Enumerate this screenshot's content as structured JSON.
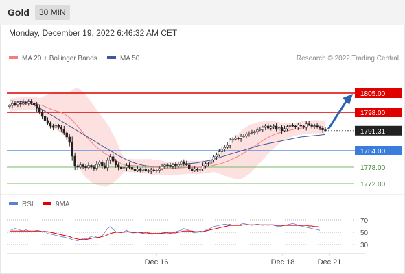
{
  "header": {
    "symbol": "Gold",
    "timeframe": "30 MIN",
    "datetime": "Monday, December 19, 2022 6:46:32 AM CET"
  },
  "legend": {
    "ma20_label": "MA 20 + Bollinger Bands",
    "ma50_label": "MA 50",
    "credit": "Research © 2022 Trading Central",
    "rsi_label": "RSI",
    "rsi_ma_label": "9MA"
  },
  "colors": {
    "ma20": "#f08080",
    "band_fill": "#fde0e0",
    "ma50": "#3d5a98",
    "resistance": "#e00000",
    "pivot": "#3b7ddd",
    "support": "#7ab86a",
    "last_price": "#222222",
    "rsi": "#5b7fd1",
    "rsi_ma": "#e00000",
    "arrow": "#2a64b0"
  },
  "chart_data": [
    {
      "type": "candlestick",
      "x_ticks": [
        "Dec 16",
        "Dec 18",
        "Dec 21"
      ],
      "ylim": [
        1768,
        1808
      ],
      "levels": [
        {
          "value": 1805.0,
          "label": "1805.00",
          "kind": "resistance"
        },
        {
          "value": 1798.0,
          "label": "1798.00",
          "kind": "resistance"
        },
        {
          "value": 1791.31,
          "label": "1791.31",
          "kind": "last"
        },
        {
          "value": 1784.0,
          "label": "1784.00",
          "kind": "pivot"
        },
        {
          "value": 1778.0,
          "label": "1778.00",
          "kind": "support"
        },
        {
          "value": 1772.0,
          "label": "1772.00",
          "kind": "support"
        }
      ],
      "close": [
        1800.5,
        1801.2,
        1800.8,
        1801.5,
        1801.0,
        1801.6,
        1801.4,
        1801.9,
        1801.3,
        1800.8,
        1799.5,
        1798.0,
        1796.5,
        1795.0,
        1794.0,
        1793.0,
        1792.5,
        1793.2,
        1792.5,
        1791.8,
        1790.5,
        1789.0,
        1787.0,
        1782.0,
        1778.5,
        1778.0,
        1778.8,
        1778.2,
        1777.8,
        1778.6,
        1778.0,
        1777.6,
        1779.0,
        1779.8,
        1778.5,
        1777.8,
        1780.5,
        1781.8,
        1780.2,
        1778.8,
        1778.0,
        1777.4,
        1777.8,
        1778.6,
        1777.9,
        1777.2,
        1776.8,
        1777.3,
        1776.9,
        1777.4,
        1776.8,
        1776.5,
        1777.0,
        1776.7,
        1776.9,
        1777.5,
        1778.2,
        1778.8,
        1778.6,
        1778.2,
        1778.9,
        1778.3,
        1779.0,
        1780.0,
        1779.3,
        1778.8,
        1777.5,
        1776.8,
        1777.3,
        1777.0,
        1777.4,
        1778.5,
        1779.3,
        1779.2,
        1780.6,
        1781.8,
        1782.5,
        1783.6,
        1784.6,
        1785.2,
        1786.0,
        1787.8,
        1788.2,
        1788.6,
        1788.4,
        1789.2,
        1789.3,
        1790.1,
        1790.4,
        1790.6,
        1791.0,
        1791.6,
        1791.8,
        1792.5,
        1793.0,
        1792.2,
        1792.8,
        1793.0,
        1791.8,
        1792.4,
        1791.3,
        1792.0,
        1792.8,
        1793.2,
        1793.0,
        1792.6,
        1793.4,
        1793.0,
        1792.6,
        1793.8,
        1793.5,
        1792.9,
        1793.1,
        1792.6,
        1792.2,
        1791.6,
        1791.3
      ],
      "ma50": [
        1802.2,
        1802.2,
        1802.1,
        1802.0,
        1801.9,
        1801.8,
        1801.7,
        1801.4,
        1801.0,
        1800.6,
        1800.2,
        1799.6,
        1799.0,
        1798.4,
        1797.8,
        1797.2,
        1796.6,
        1796.0,
        1795.4,
        1794.8,
        1794.2,
        1793.6,
        1793.0,
        1792.4,
        1791.8,
        1791.2,
        1790.6,
        1790.0,
        1789.4,
        1788.8,
        1788.2,
        1787.6,
        1787.0,
        1786.4,
        1785.8,
        1785.2,
        1784.6,
        1784.0,
        1783.4,
        1782.8,
        1782.2,
        1781.7,
        1781.2,
        1780.7,
        1780.3,
        1779.9,
        1779.5,
        1779.2,
        1778.9,
        1778.7,
        1778.5,
        1778.4,
        1778.3,
        1778.3,
        1778.3,
        1778.3,
        1778.3,
        1778.4,
        1778.5,
        1778.6,
        1778.7,
        1778.8,
        1778.9,
        1779.0,
        1779.1,
        1779.2,
        1779.3,
        1779.4,
        1779.5,
        1779.6,
        1779.8,
        1780.0,
        1780.2,
        1780.4,
        1780.6,
        1780.9,
        1781.2,
        1781.5,
        1781.8,
        1782.1,
        1782.4,
        1782.7,
        1783.0,
        1783.3,
        1783.6,
        1783.9,
        1784.2,
        1784.5,
        1784.8,
        1785.1,
        1785.4,
        1785.7,
        1786.0,
        1786.2,
        1786.4,
        1786.6,
        1786.8,
        1787.0,
        1787.2,
        1787.4,
        1787.6,
        1787.8,
        1788.0,
        1788.2,
        1788.4,
        1788.6,
        1788.8,
        1789.0,
        1789.1,
        1789.2,
        1789.3,
        1789.4,
        1789.5,
        1789.6,
        1789.7,
        1789.8,
        1789.9
      ]
    },
    {
      "type": "line",
      "title": "RSI",
      "ylim": [
        20,
        80
      ],
      "y_ticks": [
        70,
        50,
        30
      ],
      "series": [
        {
          "name": "RSI",
          "values": [
            55,
            54,
            56,
            55,
            53,
            52,
            54,
            52,
            50,
            51,
            53,
            52,
            51,
            52,
            48,
            47,
            46,
            45,
            44,
            43,
            42,
            41,
            40,
            38,
            37,
            36,
            38,
            40,
            39,
            41,
            43,
            44,
            42,
            41,
            44,
            50,
            56,
            59,
            55,
            51,
            50,
            49,
            51,
            53,
            50,
            49,
            49,
            50,
            49,
            48,
            47,
            48,
            47,
            47,
            48,
            48,
            49,
            50,
            49,
            48,
            49,
            51,
            52,
            53,
            56,
            54,
            53,
            50,
            49,
            50,
            52,
            51,
            53,
            55,
            57,
            59,
            60,
            61,
            62,
            63,
            62,
            63,
            61,
            62,
            61,
            63,
            64,
            63,
            62,
            61,
            62,
            63,
            62,
            61,
            62,
            61,
            62,
            61,
            60,
            59,
            60,
            61,
            62,
            63,
            64,
            63,
            61,
            60,
            59,
            58,
            57,
            56,
            55,
            54,
            53
          ]
        },
        {
          "name": "9MA",
          "values": [
            52,
            52,
            52,
            52,
            52,
            52,
            52,
            52,
            52,
            52,
            52,
            52,
            51,
            51,
            51,
            50,
            49,
            48,
            47,
            46,
            45,
            44,
            43,
            41,
            40,
            39,
            38,
            38,
            38,
            39,
            40,
            41,
            41,
            42,
            43,
            44,
            46,
            48,
            49,
            50,
            50,
            50,
            50,
            51,
            51,
            50,
            50,
            50,
            50,
            49,
            49,
            49,
            48,
            48,
            48,
            48,
            48,
            49,
            49,
            49,
            49,
            49,
            50,
            51,
            52,
            52,
            52,
            52,
            51,
            51,
            51,
            51,
            52,
            53,
            54,
            55,
            56,
            57,
            58,
            59,
            60,
            61,
            61,
            61,
            61,
            61,
            62,
            62,
            62,
            62,
            62,
            62,
            62,
            62,
            62,
            62,
            62,
            62,
            61,
            61,
            61,
            61,
            61,
            61,
            61,
            61,
            61,
            61,
            61,
            61,
            60,
            60,
            59,
            59,
            58
          ]
        }
      ]
    }
  ]
}
